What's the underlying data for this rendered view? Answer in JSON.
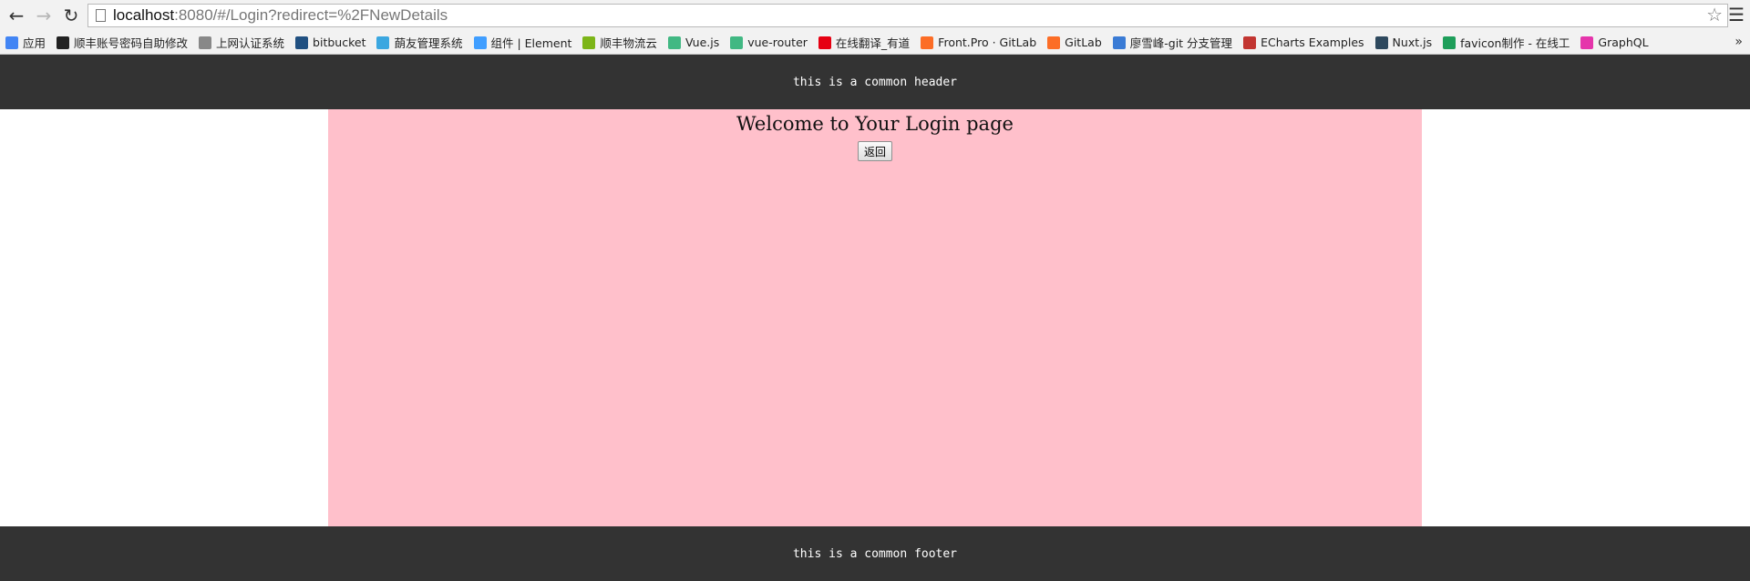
{
  "browser": {
    "url_host": "localhost",
    "url_rest": ":8080/#/Login?redirect=%2FNewDetails",
    "bookmarks": [
      {
        "label": "应用",
        "icon": "apps-grid-icon",
        "color": "#4285f4"
      },
      {
        "label": "顺丰账号密码自助修改",
        "icon": "sf-icon",
        "color": "#222222"
      },
      {
        "label": "上网认证系统",
        "icon": "page-icon",
        "color": "#888888"
      },
      {
        "label": "bitbucket",
        "icon": "bitbucket-icon",
        "color": "#205081"
      },
      {
        "label": "蓢友管理系统",
        "icon": "wing-icon",
        "color": "#3ba7e0"
      },
      {
        "label": "组件 | Element",
        "icon": "element-icon",
        "color": "#409eff"
      },
      {
        "label": "顺丰物流云",
        "icon": "cloud-icon",
        "color": "#7cb518"
      },
      {
        "label": "Vue.js",
        "icon": "vue-icon",
        "color": "#41b883"
      },
      {
        "label": "vue-router",
        "icon": "vue-icon",
        "color": "#41b883"
      },
      {
        "label": "在线翻译_有道",
        "icon": "youdao-icon",
        "color": "#e60012"
      },
      {
        "label": "Front.Pro · GitLab",
        "icon": "gitlab-icon",
        "color": "#fc6d26"
      },
      {
        "label": "GitLab",
        "icon": "gitlab-icon",
        "color": "#fc6d26"
      },
      {
        "label": "廖雪峰-git 分支管理",
        "icon": "rocket-icon",
        "color": "#3a7bd5"
      },
      {
        "label": "ECharts Examples",
        "icon": "echarts-icon",
        "color": "#c23531"
      },
      {
        "label": "Nuxt.js",
        "icon": "nuxt-icon",
        "color": "#2e495e"
      },
      {
        "label": "favicon制作 - 在线工",
        "icon": "favicon-icon",
        "color": "#1e9e5a"
      },
      {
        "label": "GraphQL",
        "icon": "graphql-icon",
        "color": "#e535ab"
      }
    ]
  },
  "page": {
    "header_text": "this is a common header",
    "title": "Welcome to Your Login page",
    "back_button": "返回",
    "footer_text": "this is a common footer"
  },
  "colors": {
    "header_bg": "#333333",
    "content_bg": "#ffc0cb",
    "footer_bg": "#333333"
  }
}
